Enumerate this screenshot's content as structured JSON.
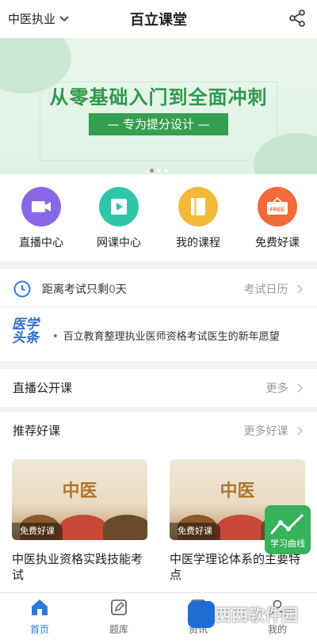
{
  "header": {
    "exam_select": "中医执业",
    "title": "百立课堂"
  },
  "banner": {
    "headline": "从零基础入门到全面冲刺",
    "subline": "— 专为提分设计 —",
    "slides_total": 3,
    "slide_active": 1
  },
  "quick": [
    {
      "label": "直播中心",
      "icon": "live-camera-icon",
      "color": "#8a67e8"
    },
    {
      "label": "网课中心",
      "icon": "video-play-icon",
      "color": "#2ec6a8"
    },
    {
      "label": "我的课程",
      "icon": "book-icon",
      "color": "#f5b93a"
    },
    {
      "label": "免费好课",
      "icon": "free-tag-icon",
      "color": "#f16a3a",
      "badge": "FREE"
    }
  ],
  "countdown": {
    "prefix": "距离考试只剩",
    "days": "0",
    "suffix": "天",
    "right": "考试日历"
  },
  "news": {
    "logo_top": "医学",
    "logo_bottom": "头条",
    "text": "百立教育整理执业医师资格考试医生的新年愿望"
  },
  "live_section": {
    "title": "直播公开课",
    "more": "更多"
  },
  "recommend_section": {
    "title": "推荐好课",
    "more": "更多好课"
  },
  "courses": [
    {
      "cover_title": "中医",
      "badge": "免费好课",
      "name": "中医执业资格实践技能考试"
    },
    {
      "cover_title": "中医",
      "badge": "免费好课",
      "name": "中医学理论体系的主要特点"
    }
  ],
  "fab": {
    "label": "学习曲线"
  },
  "tabs": [
    {
      "label": "首页",
      "icon": "home-icon",
      "active": true
    },
    {
      "label": "题库",
      "icon": "edit-icon",
      "active": false
    },
    {
      "label": "资讯",
      "icon": "news-icon",
      "active": false
    },
    {
      "label": "我的",
      "icon": "user-icon",
      "active": false
    }
  ],
  "watermark": {
    "text": "西西软件园"
  }
}
